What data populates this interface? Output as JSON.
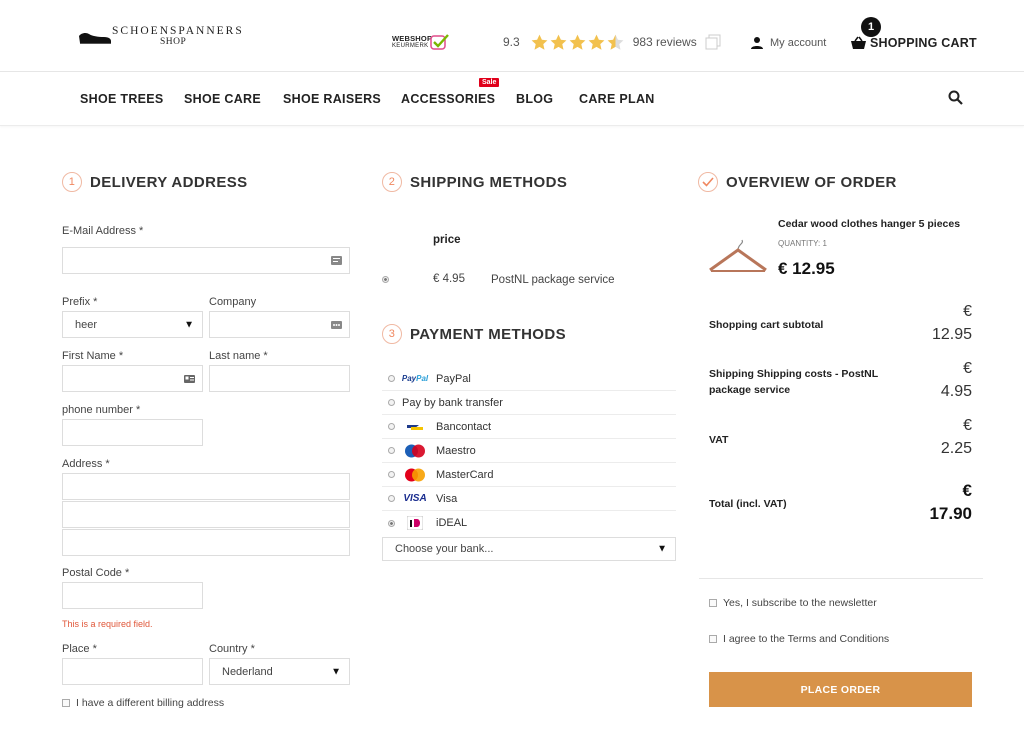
{
  "header": {
    "logo_main": "SCHOENSPANNERS",
    "logo_sub": "SHOP",
    "keurmerk_line1": "WEBSHOP",
    "keurmerk_line2": "KEURMERK",
    "rating_score": "9.3",
    "rating_stars": 4.5,
    "reviews": "983 reviews",
    "account": "My account",
    "cart_label": "SHOPPING CART",
    "cart_count": "1"
  },
  "nav": {
    "items": [
      "SHOE TREES",
      "SHOE CARE",
      "SHOE RAISERS",
      "ACCESSORIES",
      "BLOG",
      "CARE PLAN"
    ],
    "sale_badge": "Sale"
  },
  "delivery": {
    "step": "1",
    "title": "DELIVERY ADDRESS",
    "email_label": "E-Mail Address *",
    "prefix_label": "Prefix *",
    "prefix_value": "heer",
    "company_label": "Company",
    "first_name_label": "First Name *",
    "last_name_label": "Last name *",
    "phone_label": "phone number *",
    "address_label": "Address *",
    "postal_label": "Postal Code *",
    "postal_error": "This is a required field.",
    "place_label": "Place *",
    "country_label": "Country *",
    "country_value": "Nederland",
    "billing_checkbox": "I have a different billing address"
  },
  "shipping": {
    "step": "2",
    "title": "SHIPPING METHODS",
    "price_header": "price",
    "option_price": "€ 4.95",
    "option_name": "PostNL package service"
  },
  "payment": {
    "step": "3",
    "title": "PAYMENT METHODS",
    "methods": [
      "PayPal",
      "Pay by bank transfer",
      "Bancontact",
      "Maestro",
      "MasterCard",
      "Visa",
      "iDEAL"
    ],
    "bank_placeholder": "Choose your bank..."
  },
  "overview": {
    "title": "OVERVIEW OF ORDER",
    "product_name": "Cedar wood clothes hanger 5 pieces",
    "quantity": "QUANTITY: 1",
    "product_price": "€ 12.95",
    "subtotal_label": "Shopping cart subtotal",
    "subtotal_cur": "€",
    "subtotal_value": "12.95",
    "shipping_label": "Shipping Shipping  costs - PostNL package service",
    "shipping_cur": "€",
    "shipping_value": "4.95",
    "vat_label": "VAT",
    "vat_cur": "€",
    "vat_value": "2.25",
    "total_label": "Total (incl. VAT)",
    "total_cur": "€",
    "total_value": "17.90",
    "newsletter": "Yes, I subscribe to the newsletter",
    "terms": "I agree to the Terms and Conditions",
    "place_order": "PLACE ORDER"
  },
  "colors": {
    "accent": "#d89349",
    "step_circle": "#f08860",
    "error": "#e0573a",
    "star": "#f2c14e",
    "sale": "#e0001b"
  }
}
